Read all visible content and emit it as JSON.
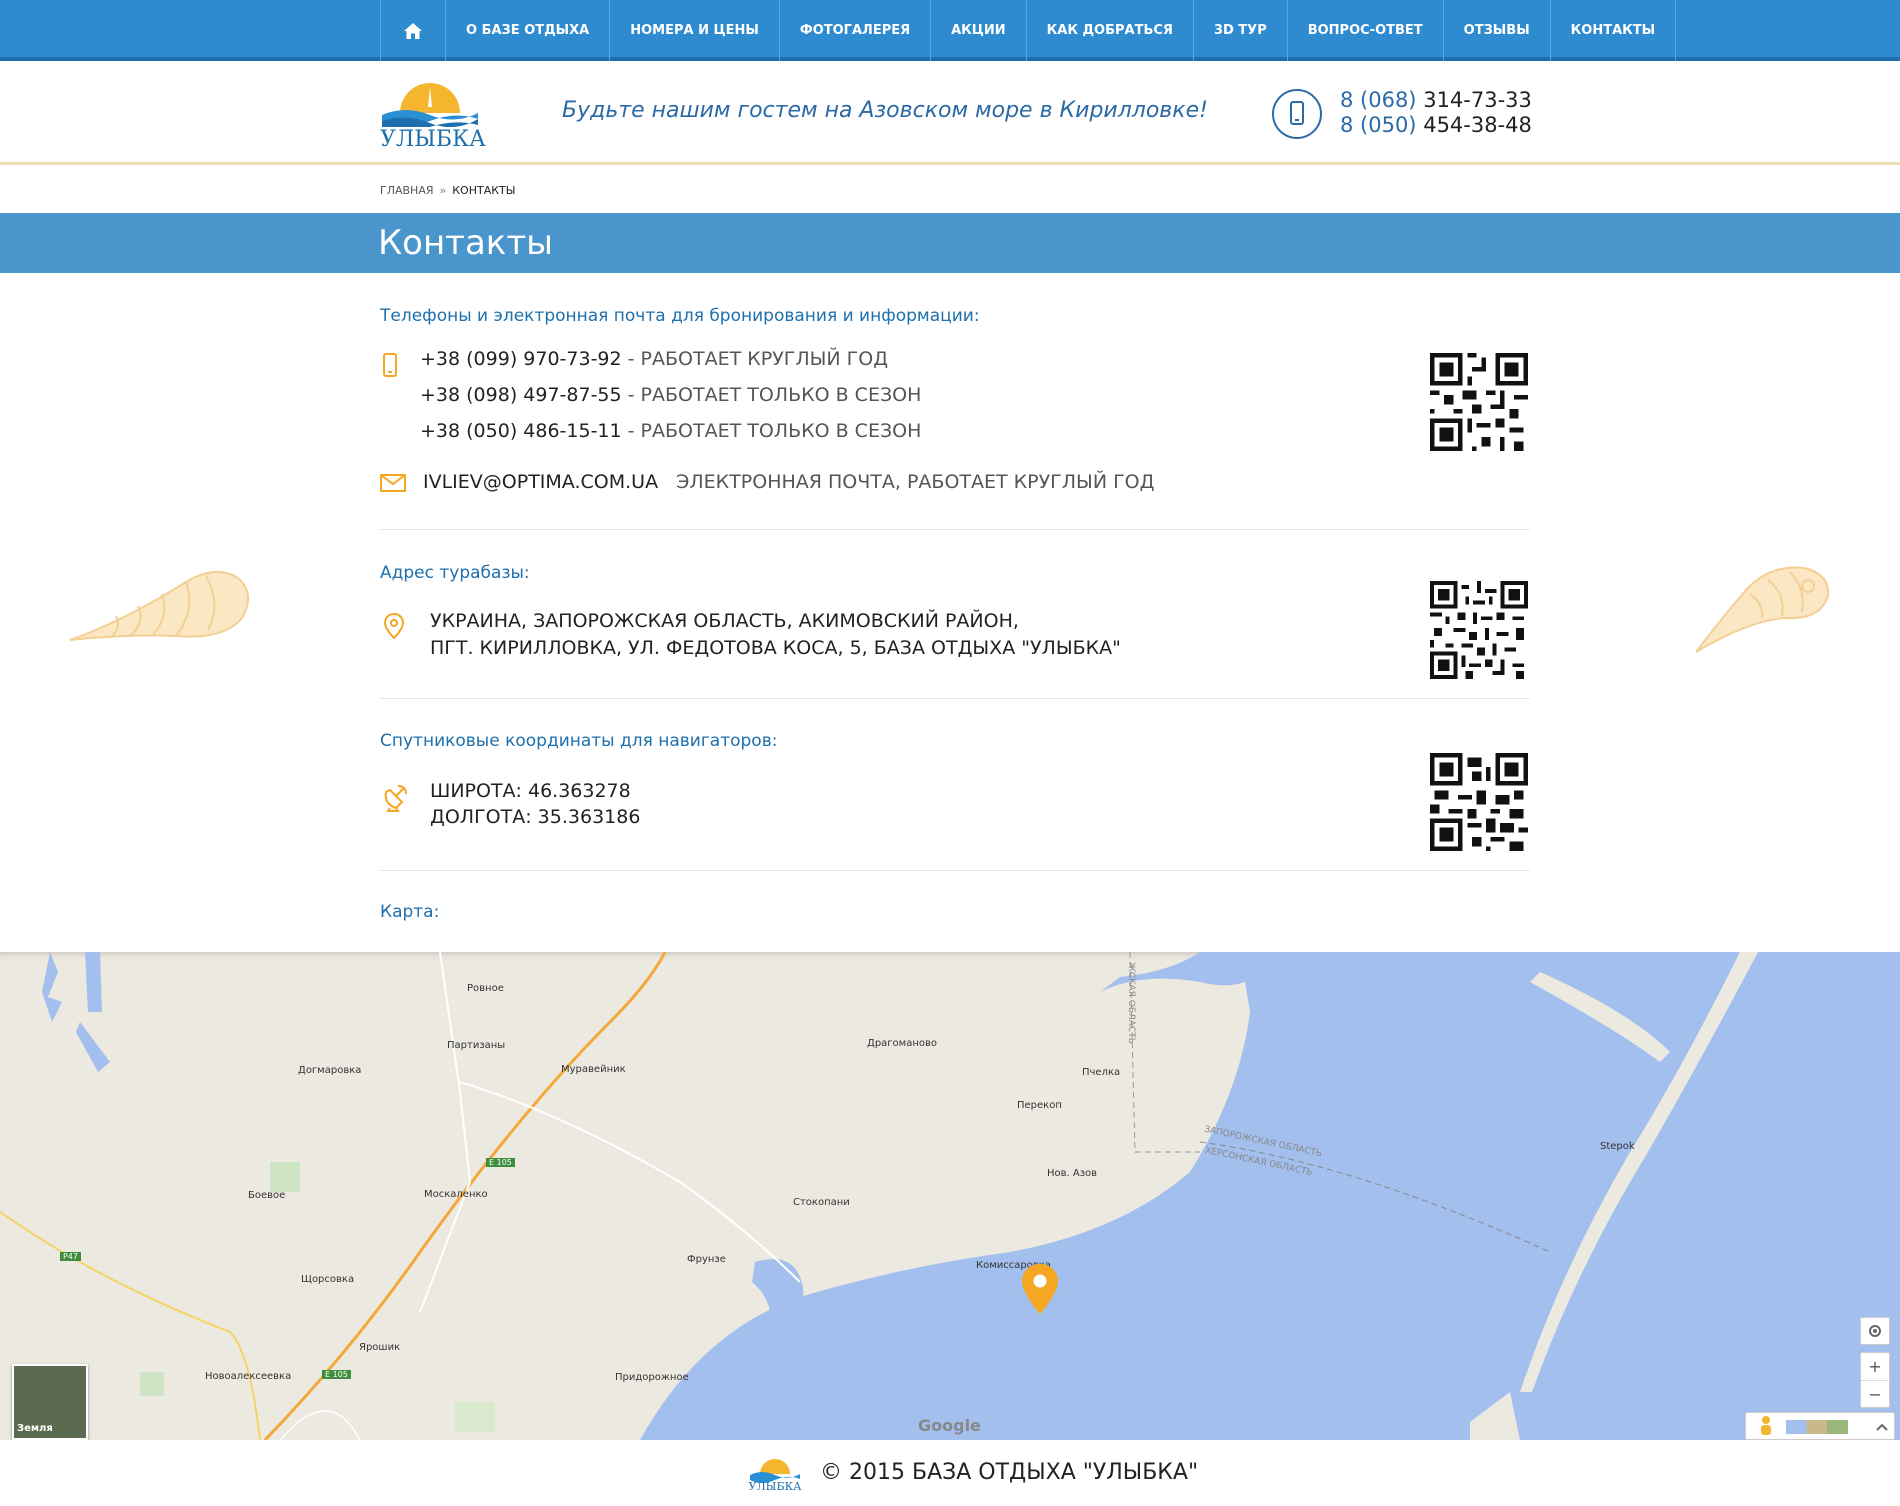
{
  "nav": {
    "items": [
      "О БАЗЕ ОТДЫХА",
      "НОМЕРА И ЦЕНЫ",
      "ФОТОГАЛЕРЕЯ",
      "АКЦИИ",
      "КАК ДОБРАТЬСЯ",
      "3D ТУР",
      "ВОПРОС-ОТВЕТ",
      "ОТЗЫВЫ",
      "КОНТАКТЫ"
    ],
    "home_icon": "home-icon"
  },
  "header": {
    "logo_text": "УЛЫБКА",
    "slogan": "Будьте нашим гостем на Азовском море в Кирилловке!",
    "phone1_code": "8 (068)",
    "phone1_num": "314-73-33",
    "phone2_code": "8 (050)",
    "phone2_num": "454-38-48"
  },
  "breadcrumb": {
    "home": "ГЛАВНАЯ",
    "sep": "»",
    "current": "КОНТАКТЫ"
  },
  "page_title": "Контакты",
  "contacts": {
    "phones_title": "Телефоны и электронная почта для бронирования и информации:",
    "phones": [
      {
        "number": "+38 (099) 970-73-92",
        "note": " - РАБОТАЕТ КРУГЛЫЙ ГОД"
      },
      {
        "number": "+38 (098) 497-87-55",
        "note": " - РАБОТАЕТ ТОЛЬКО В СЕЗОН"
      },
      {
        "number": "+38 (050) 486-15-11",
        "note": " - РАБОТАЕТ ТОЛЬКО В СЕЗОН"
      }
    ],
    "email": "IVLIEV@OPTIMA.COM.UA",
    "email_note": "ЭЛЕКТРОННАЯ ПОЧТА, РАБОТАЕТ КРУГЛЫЙ ГОД",
    "address_title": "Адрес турабазы:",
    "address_line1": "УКРАИНА, ЗАПОРОЖСКАЯ ОБЛАСТЬ, АКИМОВСКИЙ РАЙОН,",
    "address_line2": "ПГТ. КИРИЛЛОВКА, УЛ. ФЕДОТОВА КОСА, 5, БАЗА ОТДЫХА \"УЛЫБКА\"",
    "coords_title": "Спутниковые координаты для навигаторов:",
    "lat": "ШИРОТА: 46.363278",
    "lon": "ДОЛГОТА: 35.363186",
    "map_title": "Карта:"
  },
  "map": {
    "labels": [
      "Ровное",
      "Партизаны",
      "Догмаровка",
      "Муравейник",
      "Драгоманово",
      "Пчелка",
      "Перекоп",
      "Stepok",
      "Нов. Азов",
      "Стокопани",
      "Боевое",
      "Москаленко",
      "Фрунзе",
      "Комиссаровка",
      "Щорсовка",
      "Ярошик",
      "Новоалексеевка",
      "Придорожное",
      "ЗАПОРОЖСКАЯ ОБЛАСТЬ",
      "ХЕРСОНСКАЯ ОБЛАСТЬ",
      "ЖСКАЯ ОБЛАСТЬ"
    ],
    "roads": [
      "E 105",
      "E 105",
      "P47"
    ],
    "google": "Google",
    "earth_label": "Земля",
    "zoom_in": "+",
    "zoom_out": "−",
    "water_color": "#a3bfed",
    "land_color": "#ece9e1",
    "marker_color": "#f5a623"
  },
  "footer": {
    "copyright": "© 2015 БАЗА ОТДЫХА \"УЛЫБКА\"",
    "logo_text": "УЛЫБКА"
  },
  "colors": {
    "nav": "#2f8bd0",
    "title_band": "#4a96cc",
    "accent": "#f5a623",
    "link": "#1d6fad"
  }
}
